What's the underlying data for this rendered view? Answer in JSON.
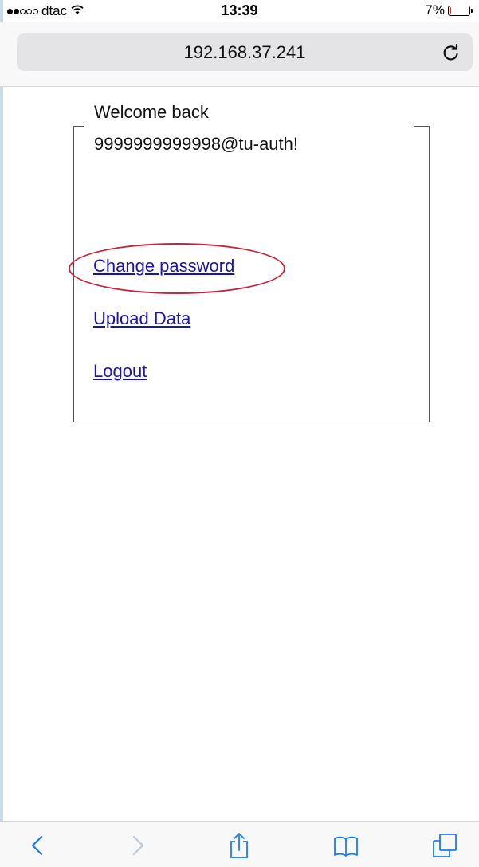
{
  "status_bar": {
    "carrier": "dtac",
    "time": "13:39",
    "battery_percent": "7%",
    "battery_level": 0.07,
    "signal_bars_filled": 2,
    "signal_bars_total": 5
  },
  "address_bar": {
    "url": "192.168.37.241"
  },
  "page": {
    "welcome": "Welcome back",
    "username": "9999999999998@tu-auth!",
    "links": {
      "change_password": "Change password",
      "upload_data": "Upload Data",
      "logout": "Logout"
    }
  },
  "colors": {
    "link": "#1a14a8",
    "annotation": "#c2263a",
    "ios_blue": "#1a7cf5",
    "battery_low": "#e2231a"
  },
  "toolbar": {
    "icons": [
      "back-icon",
      "forward-icon",
      "share-icon",
      "bookmarks-icon",
      "tabs-icon"
    ]
  }
}
